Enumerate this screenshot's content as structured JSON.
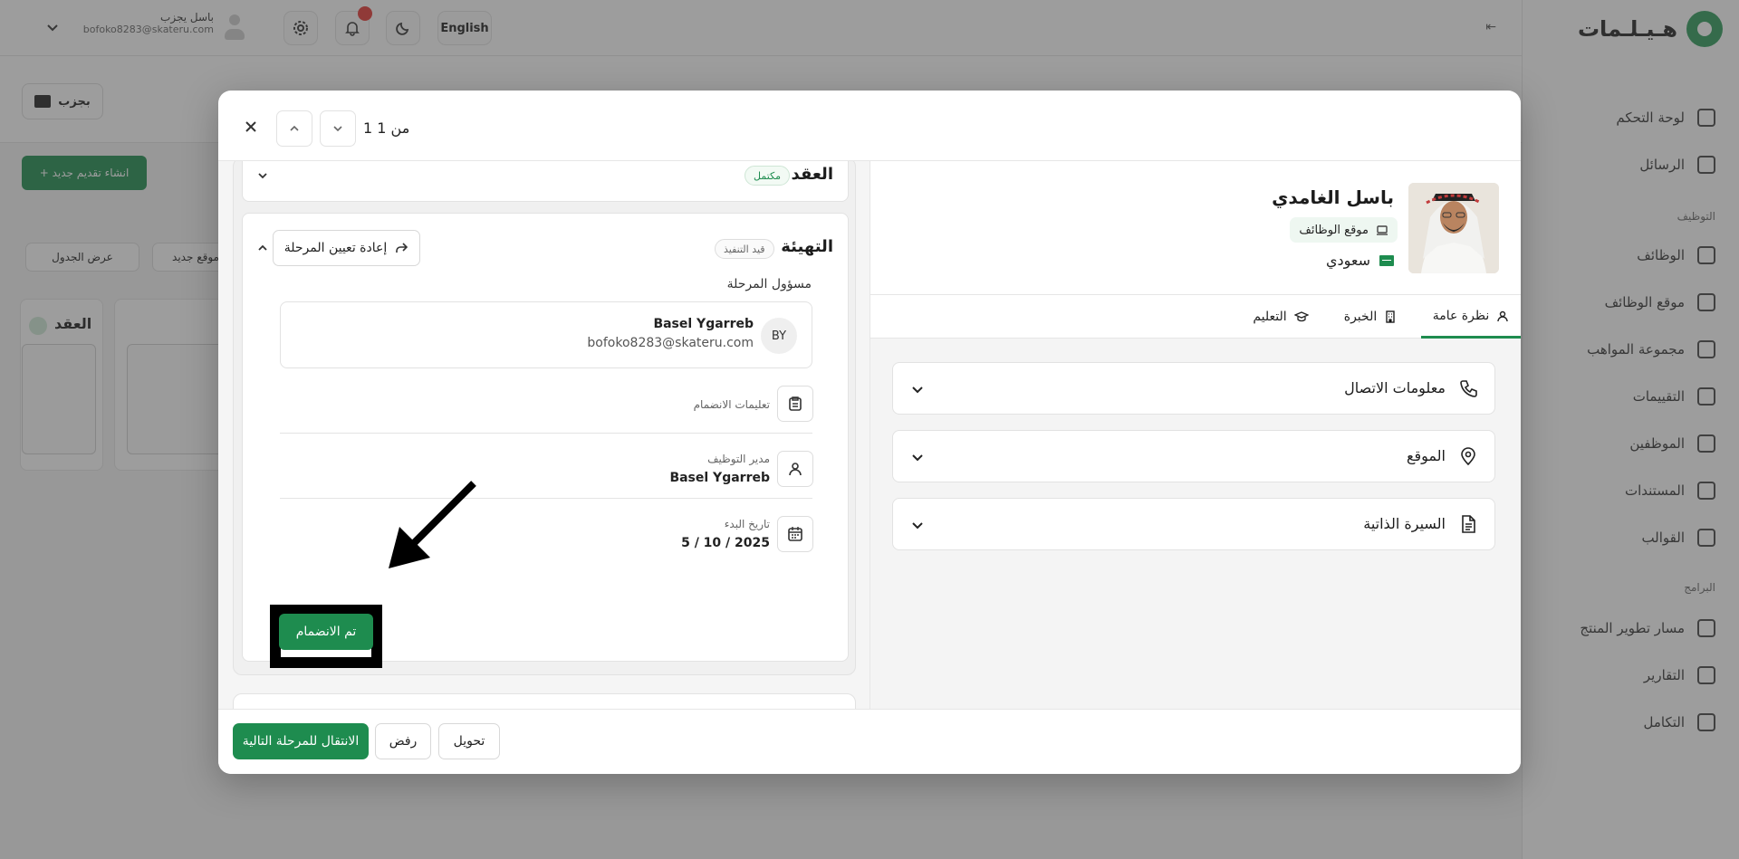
{
  "background": {
    "user": {
      "name": "باسل يجزب",
      "email": "bofoko8283@skateru.com"
    },
    "language_button": "English",
    "folder_button": "بجزب",
    "new_application_button": "+ انشاء تقديم جديد",
    "chips": [
      "عرض الجدول",
      "موقع جديد"
    ],
    "column_title": "العقد",
    "logo_text": "هـيـلـمات",
    "nav_items": [
      "لوحة التحكم",
      "الرسائل",
      "الوظائف",
      "موقع الوظائف",
      "مجموعة المواهب",
      "التقييمات",
      "الموظفين",
      "المستندات",
      "القوالب",
      "مسار تطوير المنتج",
      "التقارير",
      "التكامل"
    ],
    "nav_sections": [
      "التوظيف",
      "البرامج"
    ]
  },
  "modal": {
    "counter": "1 من 1",
    "footer": {
      "next_stage": "الانتقال للمرحلة التالية",
      "reject": "رفض",
      "transfer": "تحويل"
    },
    "contract_stage": {
      "title": "العقد",
      "status": "مكتمل"
    },
    "onboarding_stage": {
      "title": "التهيئة",
      "status": "قيد التنفيذ",
      "reassign_button": "إعادة تعيين المرحلة",
      "owner_label": "مسؤول المرحلة",
      "owner": {
        "initials": "BY",
        "name": "Basel Ygarreb",
        "email": "bofoko8283@skateru.com"
      },
      "instructions_label": "تعليمات الانضمام",
      "hiring_manager_label": "مدير التوظيف",
      "hiring_manager": "Basel Ygarreb",
      "start_date_label": "تاريخ البدء",
      "start_date": "5 / 10 / 2025",
      "joined_button": "تم الانضمام"
    },
    "candidate": {
      "name": "باسل الغامدي",
      "source": "موقع الوظائف",
      "nationality": "سعودي"
    },
    "tabs": [
      "نظرة عامة",
      "الخبرة",
      "التعليم"
    ],
    "active_tab": "نظرة عامة",
    "sections": [
      "معلومات الاتصال",
      "الموقع",
      "السيرة الذاتية"
    ]
  },
  "colors": {
    "primary": "#1e8c4f",
    "notification": "#e53935"
  }
}
